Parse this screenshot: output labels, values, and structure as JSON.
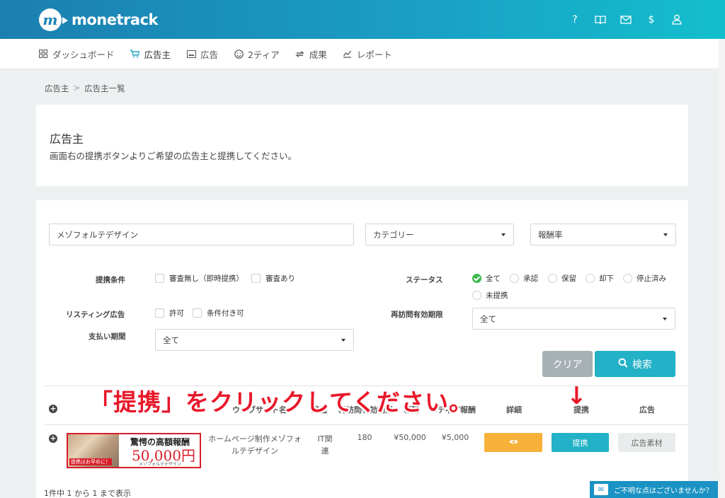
{
  "header": {
    "logo_text": "monetrack",
    "logo_mark": "m",
    "icons": [
      "help-icon",
      "manual-book-icon",
      "mail-icon",
      "dollar-icon",
      "user-icon"
    ]
  },
  "nav": {
    "items": [
      {
        "label": "ダッシュボード",
        "icon": "grid-icon"
      },
      {
        "label": "広告主",
        "icon": "cart-icon",
        "active": true
      },
      {
        "label": "広告",
        "icon": "ad-icon"
      },
      {
        "label": "2ティア",
        "icon": "smile-icon"
      },
      {
        "label": "成果",
        "icon": "exchange-icon"
      },
      {
        "label": "レポート",
        "icon": "chart-line-icon"
      }
    ]
  },
  "breadcrumb": {
    "parent": "広告主",
    "separator": ">",
    "current": "広告主一覧"
  },
  "intro": {
    "title": "広告主",
    "description": "画面右の提携ボタンよりご希望の広告主と提携してください。"
  },
  "search": {
    "keyword_value": "メゾフォルテデザイン",
    "category_value": "カテゴリー",
    "reward_rate_value": "報酬率",
    "conditions_label": "提携条件",
    "condition_options": [
      "審査無し（即時提携）",
      "審査あり"
    ],
    "status_label": "ステータス",
    "status_options": [
      "全て",
      "承認",
      "保留",
      "却下",
      "停止済み",
      "未提携"
    ],
    "listing_label": "リスティング広告",
    "listing_options": [
      "許可",
      "条件付き可"
    ],
    "revisit_label": "再訪問有効期限",
    "revisit_value": "全て",
    "payment_label": "支払い期間",
    "payment_value": "全て",
    "clear_button": "クリア",
    "search_button": "検索"
  },
  "annotation": {
    "text": "「提携」をクリックしてください。",
    "arrow": "↓"
  },
  "table": {
    "headers": [
      "",
      "広告",
      "サイト名",
      "業種",
      "再訪問有効期限",
      "報酬",
      "2ティア報酬",
      "詳細",
      "提携",
      "広告"
    ],
    "visible_headers": {
      "site": "ウェブサイト名",
      "industry": "業種",
      "revisit": "再訪問有効期限",
      "reward": "報酬",
      "tier2": "2ティア報酬",
      "detail": "詳細",
      "partner": "提携",
      "ad": "広告"
    },
    "rows": [
      {
        "banner_line1": "驚愕の高額報酬",
        "banner_amount": "50,000円",
        "banner_brand": "メゾフォルテデザイン",
        "banner_badge": "提携はお早めに！",
        "site_name": "ホームページ制作メゾフォルテデザイン",
        "industry": "IT関連",
        "revisit_days": "180",
        "reward": "¥50,000",
        "tier2_reward": "¥5,000",
        "partner_button": "提携",
        "material_button": "広告素材"
      }
    ]
  },
  "footer": {
    "count_text": "1件中 1 から 1 まで表示"
  },
  "help": {
    "label": "ご不明な点はございませんか？"
  },
  "colors": {
    "accent": "#22a4c5",
    "detail_button": "#f7b13a",
    "annotation": "#e8182a",
    "clear_button": "#a7b1b5"
  }
}
